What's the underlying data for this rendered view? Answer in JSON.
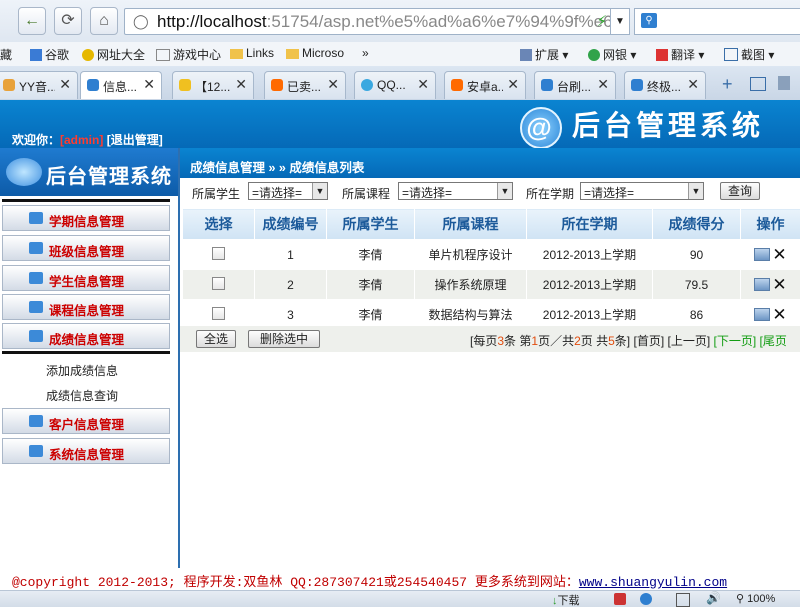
{
  "browser": {
    "url_host": "http://localhost",
    "url_rest": ":51754/asp.net%e5%ad%a6%e7%94%9f%e6",
    "bookmarks": [
      "藏",
      "谷歌",
      "网址大全",
      "游戏中心",
      "Links",
      "Microso",
      "»"
    ],
    "right_tools": [
      "扩展",
      "网银",
      "翻译",
      "截图"
    ],
    "tabs": [
      {
        "label": "YY音...",
        "color": "#e8a23a"
      },
      {
        "label": "信息...",
        "color": "#2f7fd0",
        "active": true
      },
      {
        "label": "【12...",
        "color": "#f0c020"
      },
      {
        "label": "已卖...",
        "color": "#ff6a00"
      },
      {
        "label": "QQ...",
        "color": "#3aa8e0"
      },
      {
        "label": "安卓a...",
        "color": "#ff6a00"
      },
      {
        "label": "台刷...",
        "color": "#2f7fd0"
      },
      {
        "label": "终极...",
        "color": "#2f7fd0"
      }
    ],
    "zoom": "100%",
    "download_label": "下载"
  },
  "header": {
    "welcome_prefix": "欢迎你：",
    "user": "[admin]",
    "logout": "[退出管理]",
    "logo_title": "后台管理系统"
  },
  "sidebar": {
    "title": "后台管理系统",
    "menu": [
      "学期信息管理",
      "班级信息管理",
      "学生信息管理",
      "课程信息管理",
      "成绩信息管理"
    ],
    "submenu": [
      "添加成绩信息",
      "成绩信息查询"
    ],
    "menu2": [
      "客户信息管理",
      "系统信息管理"
    ]
  },
  "breadcrumb": "成绩信息管理 » » 成绩信息列表",
  "filter": {
    "student_label": "所属学生",
    "student_value": "=请选择=",
    "course_label": "所属课程",
    "course_value": "=请选择=",
    "term_label": "所在学期",
    "term_value": "=请选择=",
    "query_button": "查询"
  },
  "table": {
    "headers": [
      "选择",
      "成绩编号",
      "所属学生",
      "所属课程",
      "所在学期",
      "成绩得分",
      "操作"
    ],
    "rows": [
      {
        "id": "1",
        "student": "李倩",
        "course": "单片机程序设计",
        "term": "2012-2013上学期",
        "score": "90"
      },
      {
        "id": "2",
        "student": "李倩",
        "course": "操作系统原理",
        "term": "2012-2013上学期",
        "score": "79.5"
      },
      {
        "id": "3",
        "student": "李倩",
        "course": "数据结构与算法",
        "term": "2012-2013上学期",
        "score": "86"
      }
    ]
  },
  "pager": {
    "select_all": "全选",
    "delete_selected": "删除选中",
    "p1": "[每页",
    "per_page": "3",
    "p2": "条 第",
    "current": "1",
    "p3": "页／共",
    "total_pages": "2",
    "p4": "页 共",
    "total_records": "5",
    "p5": "条]",
    "first": "[首页]",
    "prev": "[上一页]",
    "next": "[下一页]",
    "last": "[尾页"
  },
  "footer": {
    "copyright": "@copyright 2012-2013; 程序开发:双鱼林  QQ:287307421或254540457  更多系统到网站：",
    "site": "www.shuangyulin.com"
  }
}
